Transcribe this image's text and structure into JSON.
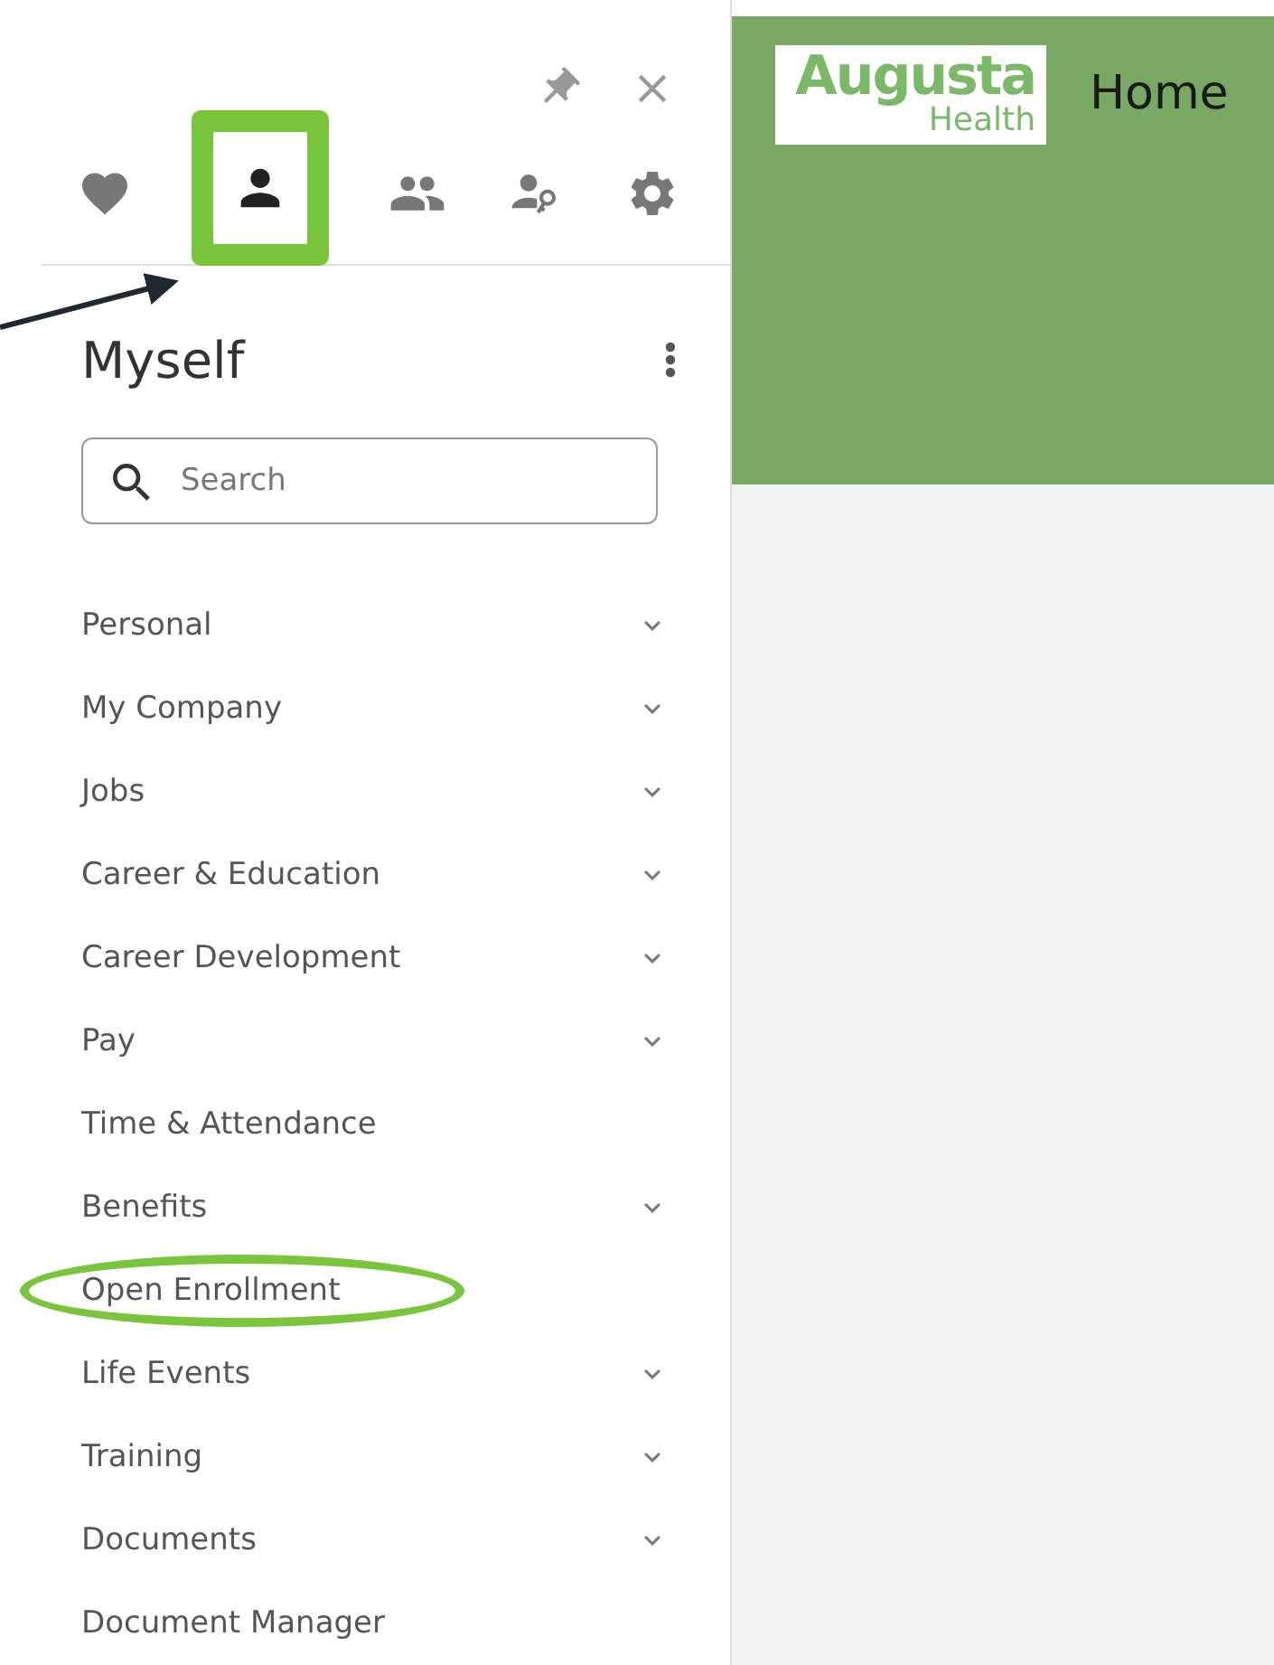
{
  "sidebar": {
    "tabs": [
      {
        "selected": false,
        "highlighted": false
      },
      {
        "selected": true,
        "highlighted": true
      },
      {
        "selected": false,
        "highlighted": false
      },
      {
        "selected": false,
        "highlighted": false
      },
      {
        "selected": false,
        "highlighted": false
      }
    ],
    "title": "Myself",
    "search": {
      "placeholder": "Search"
    },
    "items": [
      {
        "label": "Personal",
        "expandable": true,
        "circled": false
      },
      {
        "label": "My Company",
        "expandable": true,
        "circled": false
      },
      {
        "label": "Jobs",
        "expandable": true,
        "circled": false
      },
      {
        "label": "Career & Education",
        "expandable": true,
        "circled": false
      },
      {
        "label": "Career Development",
        "expandable": true,
        "circled": false
      },
      {
        "label": "Pay",
        "expandable": true,
        "circled": false
      },
      {
        "label": "Time & Attendance",
        "expandable": false,
        "circled": false
      },
      {
        "label": "Benefits",
        "expandable": true,
        "circled": false
      },
      {
        "label": "Open Enrollment",
        "expandable": false,
        "circled": true
      },
      {
        "label": "Life Events",
        "expandable": true,
        "circled": false
      },
      {
        "label": "Training",
        "expandable": true,
        "circled": false
      },
      {
        "label": "Documents",
        "expandable": true,
        "circled": false
      },
      {
        "label": "Document Manager",
        "expandable": false,
        "circled": false
      }
    ]
  },
  "header": {
    "logo": {
      "line_1": "Augusta",
      "line_2": "Health"
    },
    "title": "Home"
  }
}
